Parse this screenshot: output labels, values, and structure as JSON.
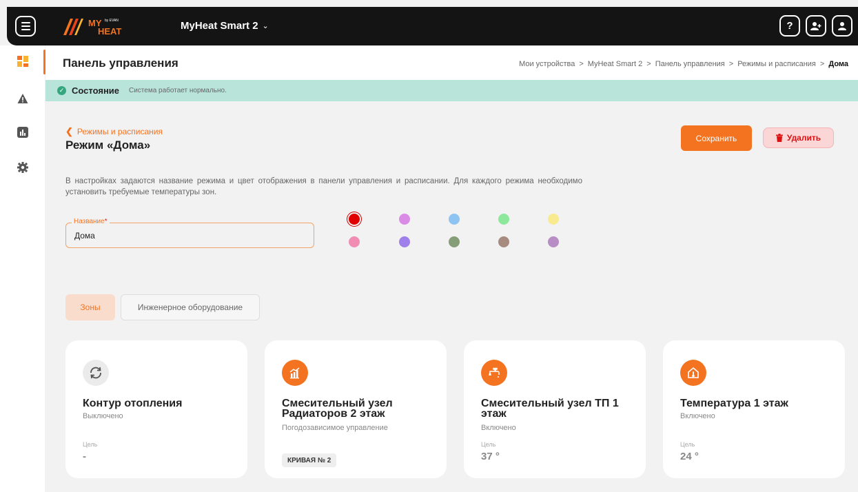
{
  "topbar": {
    "logo_text": "MY HEAT by EVAN",
    "device_name": "MyHeat Smart 2",
    "help_icon": "?"
  },
  "sidebar": {
    "items": [
      {
        "icon": "dashboard-icon",
        "active": true
      },
      {
        "icon": "warning-icon",
        "active": false
      },
      {
        "icon": "chart-icon",
        "active": false
      },
      {
        "icon": "gear-icon",
        "active": false
      }
    ]
  },
  "header": {
    "title": "Панель управления",
    "breadcrumb": [
      "Мои устройства",
      "MyHeat Smart 2",
      "Панель управления",
      "Режимы и расписания",
      "Дома"
    ],
    "separator": ">"
  },
  "status": {
    "label": "Состояние",
    "text": "Система работает нормально."
  },
  "mode": {
    "back_label": "Режимы и расписания",
    "title": "Режим «Дома»",
    "save_label": "Сохранить",
    "delete_label": "Удалить",
    "description": "В настройках задаются название режима и цвет отображения в панели управления и расписании. Для каждого режима необходимо установить требуемые температуры зон.",
    "name_label": "Название",
    "name_required": "*",
    "name_value": "Дома",
    "colors": [
      "#e00000",
      "#d98be6",
      "#8ec4f2",
      "#8ee89c",
      "#f7ea8f",
      "#f18db3",
      "#9f80ea",
      "#869e78",
      "#a78b7e",
      "#b88cc4"
    ],
    "selected_color": "#e00000"
  },
  "tabs": [
    {
      "label": "Зоны",
      "active": true
    },
    {
      "label": "Инженерное оборудование",
      "active": false
    }
  ],
  "cards": [
    {
      "icon": "refresh-circuit-icon",
      "title": "Контур отопления",
      "subtitle": "Выключено",
      "goal_label": "Цель",
      "goal_value": "-",
      "badge": ""
    },
    {
      "icon": "mixing-unit-icon",
      "title": "Смесительный узел Радиаторов 2 этаж",
      "subtitle": "Погодозависимое управление",
      "goal_label": "",
      "goal_value": "",
      "badge": "КРИВАЯ № 2"
    },
    {
      "icon": "faucet-icon",
      "title": "Смесительный узел ТП 1 этаж",
      "subtitle": "Включено",
      "goal_label": "Цель",
      "goal_value": "37 °",
      "badge": ""
    },
    {
      "icon": "house-thermometer-icon",
      "title": "Температура 1 этаж",
      "subtitle": "Включено",
      "goal_label": "Цель",
      "goal_value": "24 °",
      "badge": ""
    }
  ]
}
